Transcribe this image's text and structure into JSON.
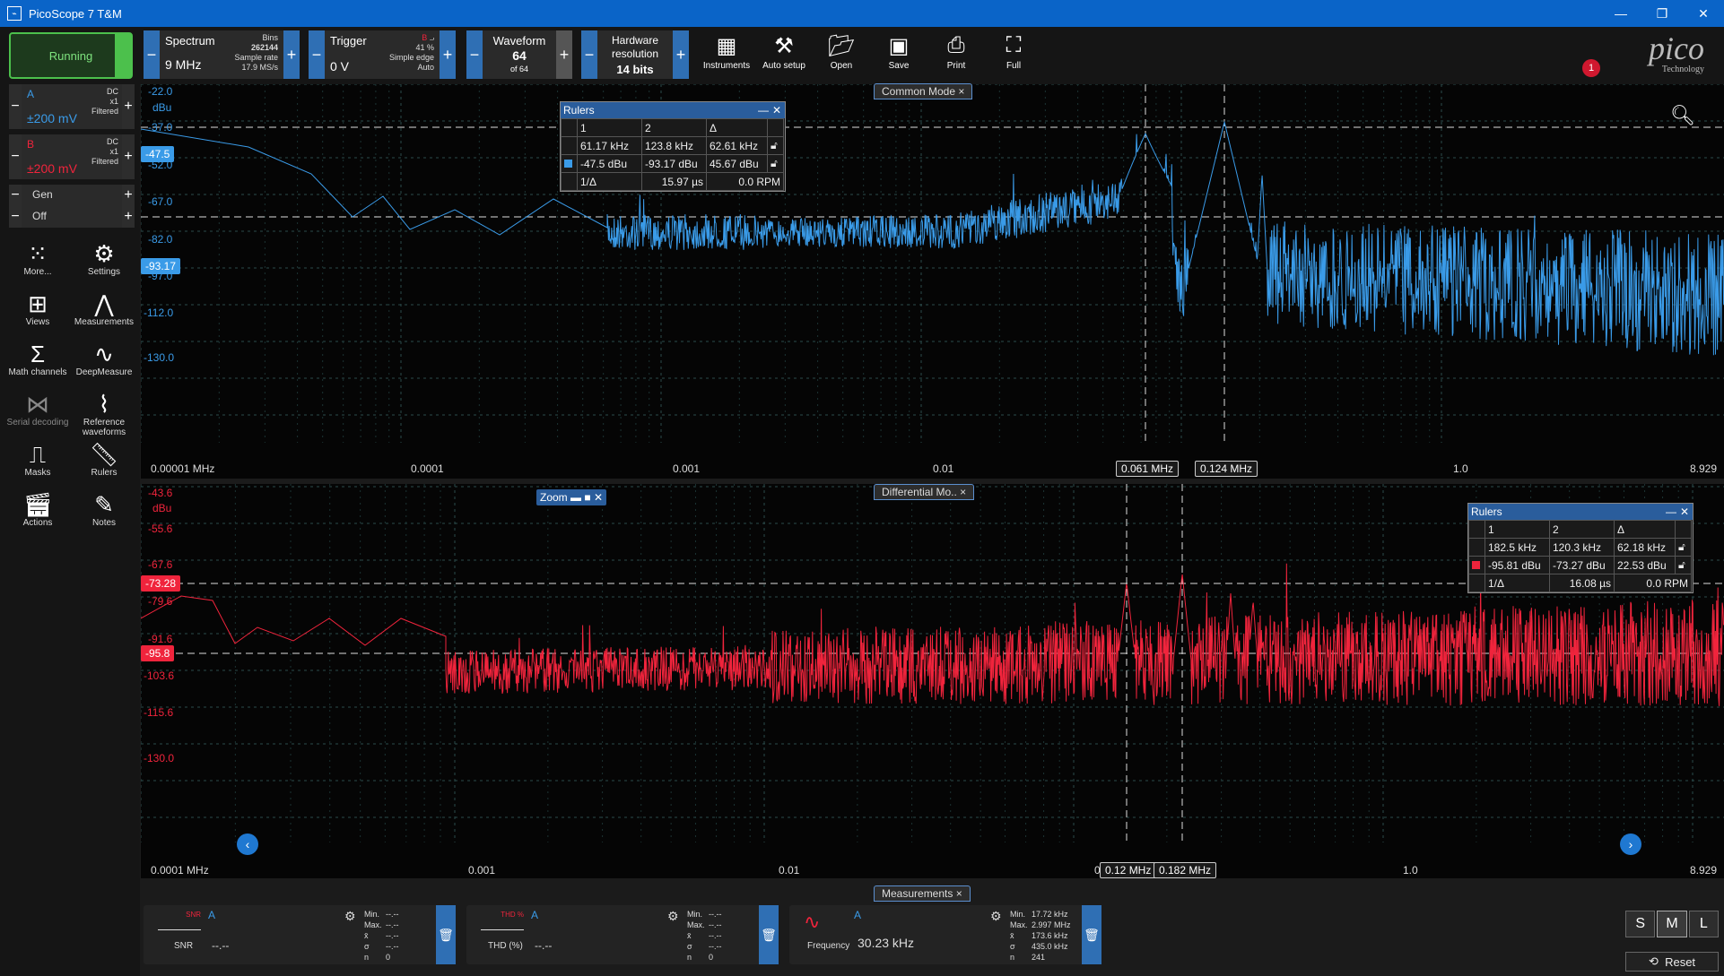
{
  "app_title": "PicoScope 7 T&M",
  "toolbar": {
    "run_label": "Running",
    "spectrum": {
      "title": "Spectrum",
      "value": "9 MHz",
      "bins_label": "Bins",
      "bins": "262144",
      "rate_label": "Sample rate",
      "rate": "17.9 MS/s"
    },
    "trigger": {
      "title": "Trigger",
      "value": "0 V",
      "source": "B",
      "pct": "41 %",
      "type": "Simple edge",
      "mode": "Auto"
    },
    "waveform": {
      "title": "Waveform",
      "value": "64",
      "of": "of 64"
    },
    "resolution": {
      "title": "Hardware resolution",
      "value": "14 bits"
    },
    "tools": [
      "Instruments",
      "Auto setup",
      "Open",
      "Save",
      "Print",
      "Full"
    ],
    "logo_text": "pico",
    "logo_sub": "Technology",
    "notification_count": "1"
  },
  "channels": [
    {
      "name": "A",
      "coupling": "DC",
      "probe": "x1",
      "filter": "Filtered",
      "range": "±200 mV",
      "color": "#3a9be8"
    },
    {
      "name": "B",
      "coupling": "DC",
      "probe": "x1",
      "filter": "Filtered",
      "range": "±200 mV",
      "color": "#f0243c"
    }
  ],
  "gen": {
    "label": "Gen",
    "state": "Off"
  },
  "sidebar_tools": [
    "More...",
    "Settings",
    "Views",
    "Measurements",
    "Math channels",
    "DeepMeasure",
    "Serial decoding",
    "Reference waveforms",
    "Masks",
    "Rulers",
    "Actions",
    "Notes"
  ],
  "top_view": {
    "tab": "Common Mode",
    "unit": "dBu",
    "y_ticks": [
      "-22.0",
      "-37.0",
      "-52.0",
      "-67.0",
      "-82.0",
      "-97.0",
      "-112.0",
      "-130.0"
    ],
    "x_ticks": [
      "0.00001 MHz",
      "0.0001",
      "0.001",
      "0.01",
      "1.0",
      "8.929"
    ],
    "ruler_y": [
      "-47.5",
      "-93.17"
    ],
    "ruler_x": [
      "0.061 MHz",
      "0.124 MHz"
    ],
    "rulers": {
      "title": "Rulers",
      "head": [
        "1",
        "2",
        "Δ"
      ],
      "freq": [
        "61.17 kHz",
        "123.8 kHz",
        "62.61 kHz"
      ],
      "amp": [
        "-47.5 dBu",
        "-93.17 dBu",
        "45.67 dBu"
      ],
      "inv_label": "1/Δ",
      "inv": "15.97 µs",
      "rpm": "0.0 RPM"
    }
  },
  "bottom_view": {
    "tab": "Differential Mo..",
    "zoom_label": "Zoom",
    "unit": "dBu",
    "y_ticks": [
      "-43.6",
      "-55.6",
      "-67.6",
      "-79.6",
      "-91.6",
      "-103.6",
      "-115.6",
      "-130.0"
    ],
    "x_ticks": [
      "0.0001 MHz",
      "0.001",
      "0.01",
      "0",
      "1.0",
      "8.929"
    ],
    "ruler_y": [
      "-73.28",
      "-95.8"
    ],
    "ruler_x": [
      "0.12 MHz",
      "0.182 MHz"
    ],
    "rulers": {
      "title": "Rulers",
      "head": [
        "1",
        "2",
        "Δ"
      ],
      "freq": [
        "182.5 kHz",
        "120.3 kHz",
        "62.18 kHz"
      ],
      "amp": [
        "-95.81 dBu",
        "-73.27 dBu",
        "22.53 dBu"
      ],
      "inv_label": "1/Δ",
      "inv": "16.08 µs",
      "rpm": "0.0 RPM"
    }
  },
  "measurements": {
    "tab": "Measurements",
    "items": [
      {
        "name": "SNR",
        "icon_label": "SNR",
        "channel": "A",
        "value": "--.--",
        "min": "--.--",
        "max": "--.--",
        "mean": "--.--",
        "sd": "--.--",
        "n": "0"
      },
      {
        "name": "THD (%)",
        "icon_label": "THD %",
        "channel": "A",
        "value": "--.--",
        "min": "--.--",
        "max": "--.--",
        "mean": "--.--",
        "sd": "--.--",
        "n": "0"
      },
      {
        "name": "Frequency",
        "icon_label": "",
        "channel": "A",
        "value": "30.23 kHz",
        "min": "17.72 kHz",
        "max": "2.997 MHz",
        "mean": "173.6 kHz",
        "sd": "435.0 kHz",
        "n": "241"
      }
    ],
    "stat_labels": [
      "Min.",
      "Max.",
      "x̄",
      "σ",
      "n"
    ]
  },
  "sizes": [
    "S",
    "M",
    "L"
  ],
  "reset_label": "Reset"
}
